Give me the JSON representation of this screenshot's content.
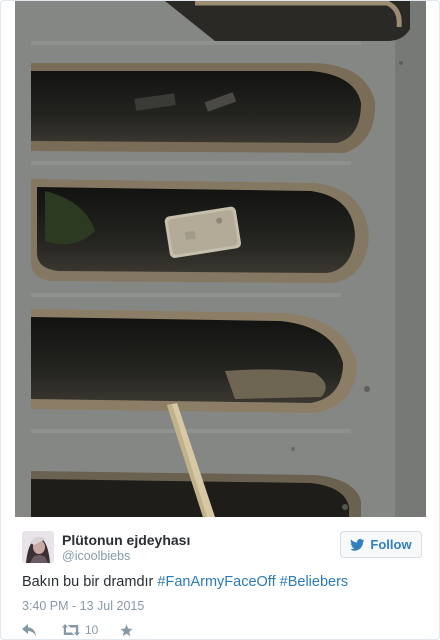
{
  "photo": {
    "alt_subject": "phone-in-storm-drain-photo"
  },
  "tweet": {
    "author": {
      "display_name": "Plütonun ejdeyhası",
      "handle": "@icoolbiebs"
    },
    "follow_label": "Follow",
    "text": {
      "plain": "Bakın bu bir dramdır ",
      "hashtag_1": "#FanArmyFaceOff",
      "space": " ",
      "hashtag_2": "#Beliebers"
    },
    "timestamp": "3:40 PM - 13 Jul 2015",
    "retweet_count": "10"
  },
  "icons": {
    "reply": "reply-icon",
    "retweet": "retweet-icon",
    "like": "star-icon",
    "follow": "twitter-bird-icon"
  },
  "colors": {
    "link": "#2b7bb9",
    "muted": "#8899a6",
    "text": "#292f33"
  }
}
